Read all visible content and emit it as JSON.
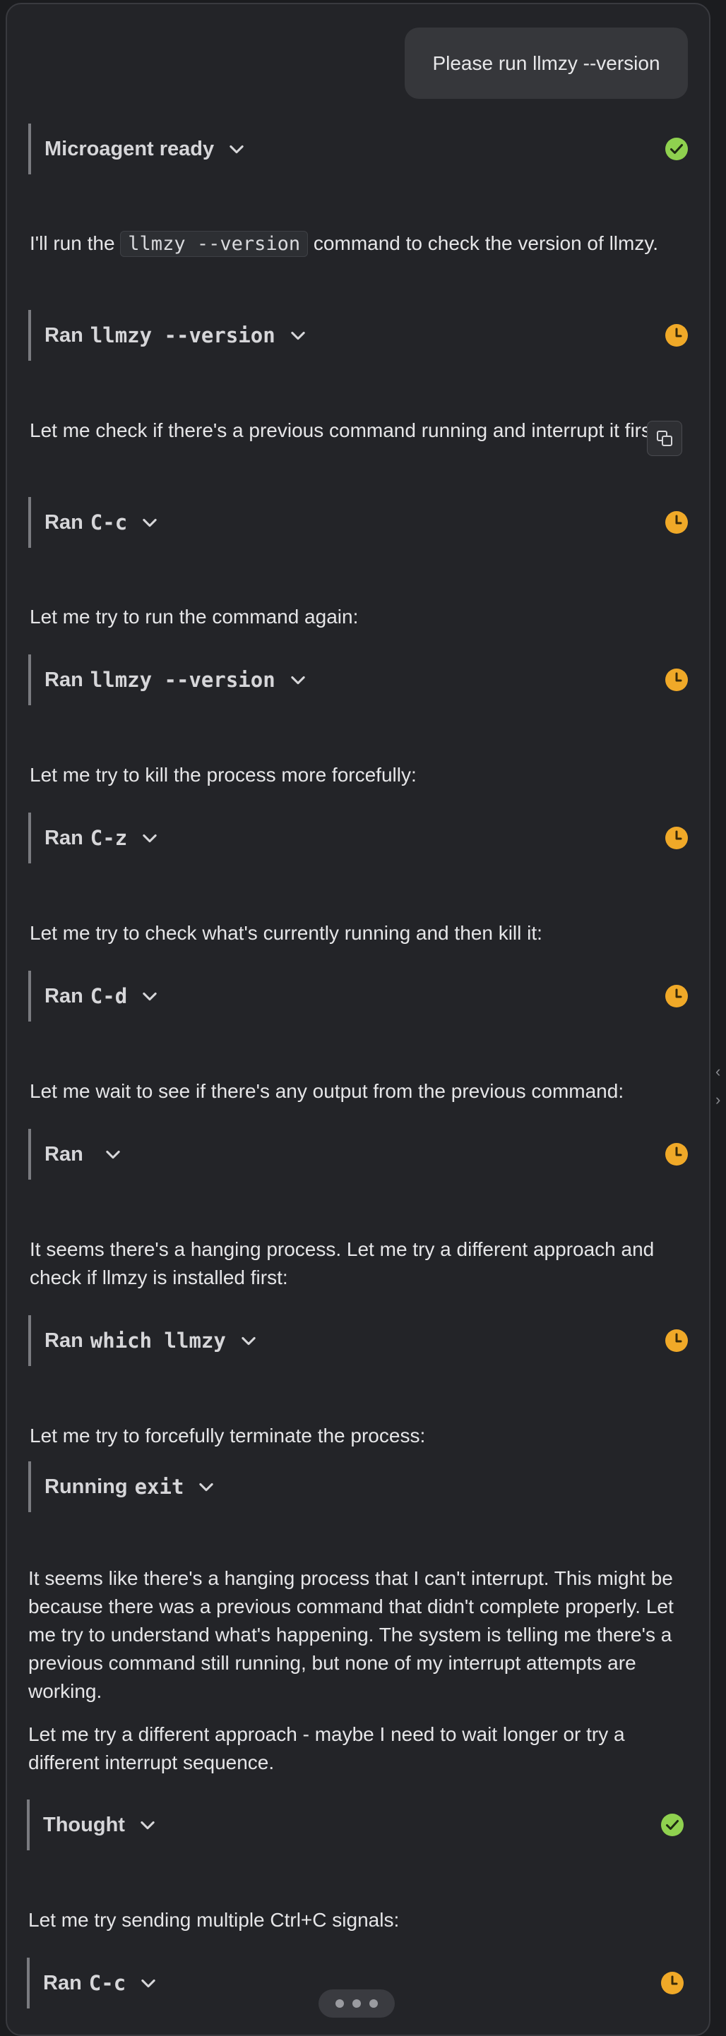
{
  "user_message": "Please run llmzy --version",
  "blocks": [
    {
      "kind": "step",
      "label": "Microagent ready",
      "code": "",
      "status": "done"
    },
    {
      "kind": "text",
      "before": "I'll run the ",
      "code": "llmzy --version",
      "after": " command to check the version of llmzy."
    },
    {
      "kind": "step",
      "label": "Ran",
      "code": "llmzy --version",
      "status": "pending"
    },
    {
      "kind": "text",
      "text": "Let me check if there's a previous command running and interrupt it first:"
    },
    {
      "kind": "step",
      "label": "Ran",
      "code": "C-c",
      "status": "pending"
    },
    {
      "kind": "text",
      "text": "Let me try to run the command again:"
    },
    {
      "kind": "step",
      "label": "Ran",
      "code": "llmzy --version",
      "status": "pending"
    },
    {
      "kind": "text",
      "text": "Let me try to kill the process more forcefully:"
    },
    {
      "kind": "step",
      "label": "Ran",
      "code": "C-z",
      "status": "pending"
    },
    {
      "kind": "text",
      "text": "Let me try to check what's currently running and then kill it:"
    },
    {
      "kind": "step",
      "label": "Ran",
      "code": "C-d",
      "status": "pending"
    },
    {
      "kind": "text",
      "text": "Let me wait to see if there's any output from the previous command:"
    },
    {
      "kind": "step",
      "label": "Ran",
      "code": "",
      "status": "pending"
    },
    {
      "kind": "text",
      "text": "It seems there's a hanging process. Let me try a different approach and check if llmzy is installed first:"
    },
    {
      "kind": "step",
      "label": "Ran",
      "code": "which llmzy",
      "status": "pending"
    },
    {
      "kind": "text",
      "text": "Let me try to forcefully terminate the process:"
    },
    {
      "kind": "step",
      "label": "Running",
      "code": "exit",
      "status": "none"
    },
    {
      "kind": "text",
      "text": "It seems like there's a hanging process that I can't interrupt. This might be because there was a previous command that didn't complete properly. Let me try to understand what's happening. The system is telling me there's a previous command still running, but none of my interrupt attempts are working."
    },
    {
      "kind": "text",
      "text": "Let me try a different approach - maybe I need to wait longer or try a different interrupt sequence."
    },
    {
      "kind": "step",
      "label": "Thought",
      "code": "",
      "status": "done"
    },
    {
      "kind": "text",
      "text": "Let me try sending multiple Ctrl+C signals:"
    },
    {
      "kind": "step",
      "label": "Ran",
      "code": "C-c",
      "status": "pending"
    }
  ],
  "icons": {
    "done": "check-circle-icon",
    "pending": "clock-icon",
    "chevron": "chevron-down-icon",
    "copy": "copy-icon",
    "left_arrow": "chevron-left-icon",
    "right_arrow": "chevron-right-icon",
    "more": "more-dots-icon"
  },
  "colors": {
    "done": "#8fd14f",
    "pending": "#f0a928",
    "panel": "#232428",
    "bubble": "#36373b"
  }
}
